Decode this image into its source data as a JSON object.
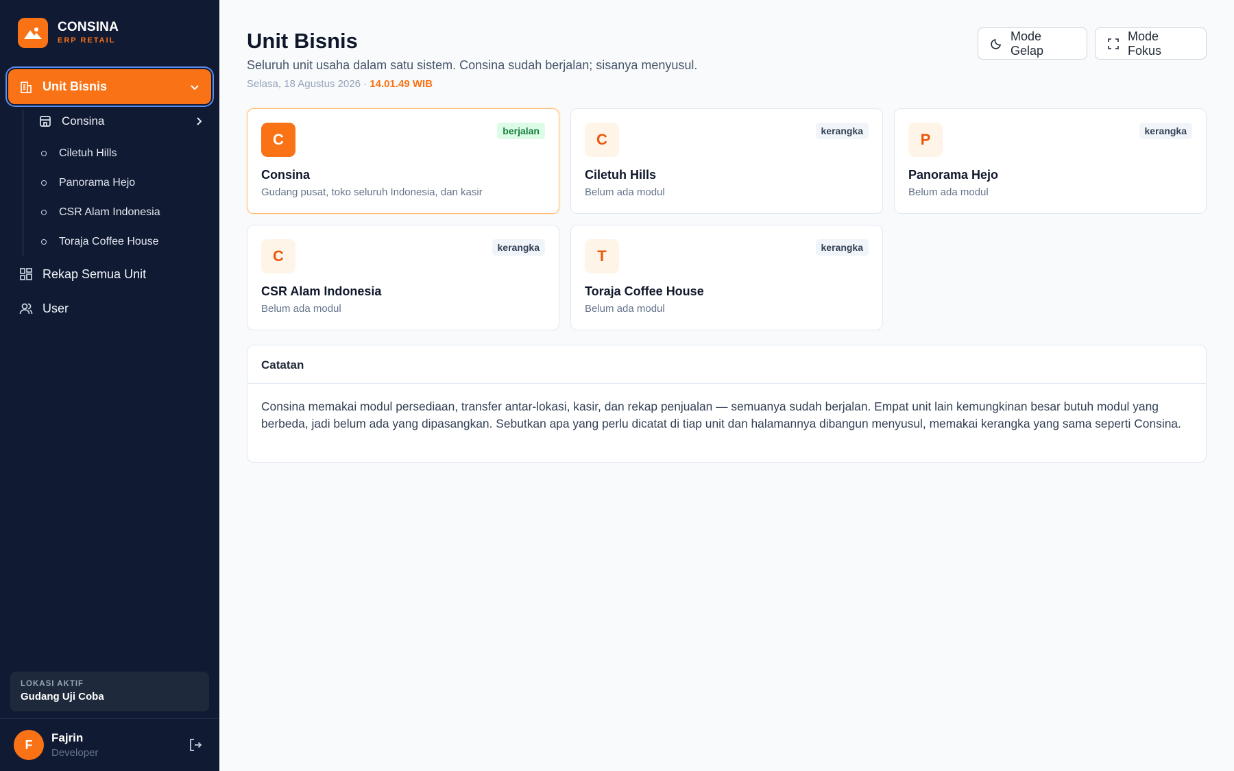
{
  "brand": {
    "name": "CONSINA",
    "sub": "ERP RETAIL"
  },
  "sidebar": {
    "active": {
      "label": "Unit Bisnis"
    },
    "sub_expand": {
      "label": "Consina"
    },
    "sub_items": [
      {
        "label": "Ciletuh Hills"
      },
      {
        "label": "Panorama Hejo"
      },
      {
        "label": "CSR Alam Indonesia"
      },
      {
        "label": "Toraja Coffee House"
      }
    ],
    "items": [
      {
        "label": "Rekap Semua Unit"
      },
      {
        "label": "User"
      }
    ],
    "location": {
      "label": "LOKASI AKTIF",
      "value": "Gudang Uji Coba"
    },
    "user": {
      "initial": "F",
      "name": "Fajrin",
      "role": "Developer"
    }
  },
  "header": {
    "title": "Unit Bisnis",
    "description": "Seluruh unit usaha dalam satu sistem. Consina sudah berjalan; sisanya menyusul.",
    "date": "Selasa, 18 Agustus 2026 ·",
    "time": "14.01.49 WIB",
    "dark_mode_label": "Mode Gelap",
    "focus_mode_label": "Mode Fokus"
  },
  "units": [
    {
      "initial": "C",
      "status": "berjalan",
      "name": "Consina",
      "description": "Gudang pusat, toko seluruh Indonesia, dan kasir"
    },
    {
      "initial": "C",
      "status": "kerangka",
      "name": "Ciletuh Hills",
      "description": "Belum ada modul"
    },
    {
      "initial": "P",
      "status": "kerangka",
      "name": "Panorama Hejo",
      "description": "Belum ada modul"
    },
    {
      "initial": "C",
      "status": "kerangka",
      "name": "CSR Alam Indonesia",
      "description": "Belum ada modul"
    },
    {
      "initial": "T",
      "status": "kerangka",
      "name": "Toraja Coffee House",
      "description": "Belum ada modul"
    }
  ],
  "notes": {
    "title": "Catatan",
    "body": "Consina memakai modul persediaan, transfer antar-lokasi, kasir, dan rekap penjualan — semuanya sudah berjalan. Empat unit lain kemungkinan besar butuh modul yang berbeda, jadi belum ada yang dipasangkan. Sebutkan apa yang perlu dicatat di tiap unit dan halamannya dibangun menyusul, memakai kerangka yang sama seperti Consina."
  },
  "colors": {
    "accent": "#f97316",
    "sidebar_bg": "#111a33",
    "success": "#15803d"
  }
}
